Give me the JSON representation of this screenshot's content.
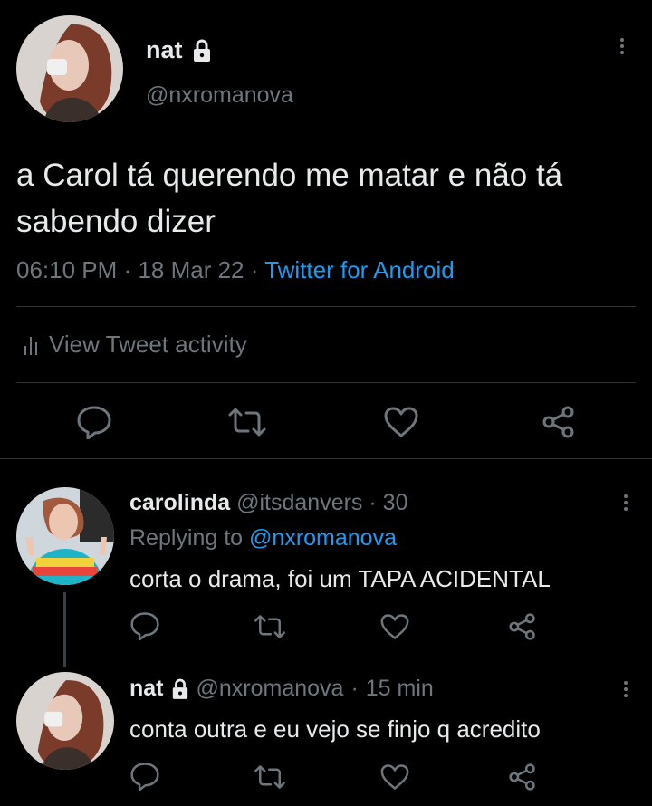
{
  "main_tweet": {
    "display_name": "nat",
    "handle": "@nxromanova",
    "text": "a Carol tá querendo me matar e não tá sabendo dizer",
    "time": "06:10 PM",
    "sep": "·",
    "date": "18 Mar 22",
    "source": "Twitter for Android",
    "activity_label": "View Tweet activity"
  },
  "replies": [
    {
      "display_name": "carolinda",
      "handle": "@itsdanvers",
      "sep": "·",
      "time": "30",
      "replying_prefix": "Replying to",
      "replying_handle": "@nxromanova",
      "text": "corta o drama, foi um TAPA ACIDENTAL"
    },
    {
      "display_name": "nat",
      "handle": "@nxromanova",
      "sep": "·",
      "time": "15 min",
      "text": "conta outra e eu vejo se finjo q acredito"
    }
  ],
  "icons": [
    "lock-icon",
    "more-icon",
    "bar-chart-icon",
    "reply-icon",
    "retweet-icon",
    "like-icon",
    "share-icon"
  ],
  "colors": {
    "background": "#000000",
    "text": "#e7e9ea",
    "muted": "#6e767d",
    "link": "#1d9bf0",
    "divider": "#2f3336"
  }
}
